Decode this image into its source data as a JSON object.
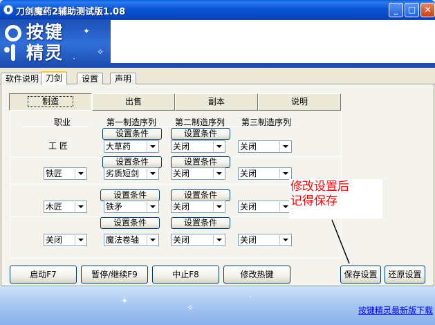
{
  "window": {
    "title": "刀剑魔药2辅助测试版1.08",
    "minimize_icon": "minimize-icon",
    "maximize_icon": "maximize-icon",
    "close_icon": "close-icon"
  },
  "banner": {
    "logo_line1": "按键",
    "logo_line2": "精灵"
  },
  "tabs": [
    {
      "label": "软件说明"
    },
    {
      "label": "刀剑"
    },
    {
      "label": "设置"
    },
    {
      "label": "声明"
    }
  ],
  "subtabs": [
    {
      "label": "制造"
    },
    {
      "label": "出售"
    },
    {
      "label": "副本"
    },
    {
      "label": "说明"
    }
  ],
  "headers": {
    "job": "职业",
    "seq1": "第一制造序列",
    "seq2": "第二制造序列",
    "seq3": "第三制造序列",
    "job_static": "工  匠"
  },
  "condition_label": "设置条件",
  "rows": [
    {
      "job": "",
      "seq1": "大草药",
      "seq2": "关闭",
      "seq3": "关闭"
    },
    {
      "job": "铁匠",
      "seq1": "劣质短剑",
      "seq2": "关闭",
      "seq3": "关闭"
    },
    {
      "job": "木匠",
      "seq1": "铁矛",
      "seq2": "关闭",
      "seq3": "关闭"
    },
    {
      "job": "关闭",
      "seq1": "魔法卷轴",
      "seq2": "关闭",
      "seq3": "关闭"
    }
  ],
  "note": {
    "line1": "修改设置后",
    "line2": "记得保存"
  },
  "buttons": {
    "start": "启动F7",
    "pause": "暂停/继续F9",
    "stop": "中止F8",
    "hotkey": "修改热键",
    "save": "保存设置",
    "restore": "还原设置"
  },
  "footer": {
    "link": "按键精灵最新版下载"
  },
  "colors": {
    "title_bar": "#0A55D6",
    "note_text": "#FF0000",
    "link": "#0000EE",
    "tab_highlight": "#FFC83C"
  }
}
